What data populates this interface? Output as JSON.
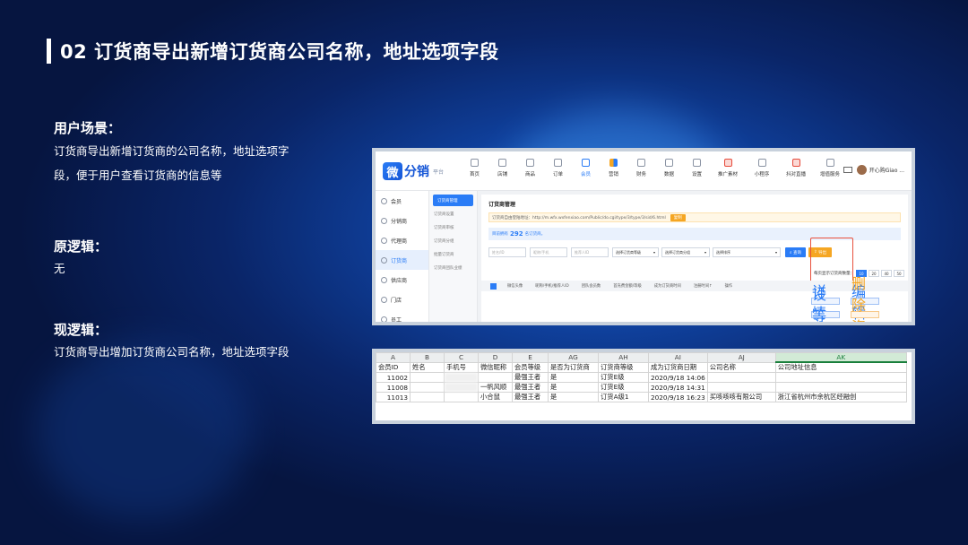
{
  "slide": {
    "title": "02 订货商导出新增订货商公司名称，地址选项字段",
    "sections": [
      {
        "heading": "用户场景：",
        "body": "订货商导出新增订货商的公司名称，地址选项字段，便于用户查看订货商的信息等"
      },
      {
        "heading": "原逻辑：",
        "body": "无"
      },
      {
        "heading": "现逻辑：",
        "body": "订货商导出增加订货商公司名称，地址选项字段"
      }
    ]
  },
  "app": {
    "logo_mark": "微",
    "logo_text": "分销",
    "logo_sub": "平台",
    "nav": [
      "首页",
      "店铺",
      "商品",
      "订单",
      "会员",
      "营销",
      "财务",
      "数据",
      "设置",
      "推广素材",
      "小程序",
      "抖对直播",
      "增值服务"
    ],
    "active_nav": "会员",
    "user_name": "开心购Giao ...",
    "sidebar": [
      "会员",
      "分销商",
      "代理商",
      "订货商",
      "供应商",
      "门店",
      "员工"
    ],
    "active_sidebar": "订货商",
    "subsidebar": [
      "订货商管理",
      "订货商设置",
      "订货商审核",
      "订货商分组",
      "批量订货商",
      "订货商团队业绩"
    ],
    "active_sub": "订货商管理",
    "page_title": "订货商管理",
    "link_text": "订货商自由登陆地址：http://m.wfx.wxfenxiao.com/Public/do.cgi/type/3/type/3/sid/6.html",
    "link_copy": "复制",
    "info_prefix": "目前拥有",
    "info_count": "292",
    "info_suffix": "名订货商。",
    "filters": {
      "inputs": [
        "姓名/ID",
        "昵称/手机",
        "推荐人ID"
      ],
      "selects": [
        "选择订货商等级",
        "选择订货商分组",
        "选择排序"
      ],
      "search_btn": "查询",
      "export_btn": "导出"
    },
    "page_size_label": "每页显示订货商数量：",
    "page_sizes": [
      "10",
      "20",
      "40",
      "50"
    ],
    "active_page_size": "10",
    "table_headers": [
      "微信头像",
      "昵称/手机/推荐人ID",
      "团队会员数",
      "首充费金额/等级",
      "成为订货商时间",
      "注册时间↑",
      "操作"
    ],
    "row_actions": [
      "详情",
      "编辑",
      "设等级",
      "删除资质"
    ]
  },
  "sheet": {
    "columns": [
      "A",
      "B",
      "C",
      "D",
      "E",
      "AG",
      "AH",
      "AI",
      "AJ",
      "AK"
    ],
    "selected_column": "AK",
    "header_row": [
      "会员ID",
      "姓名",
      "手机号",
      "微信昵称",
      "会员等级",
      "是否为订货商",
      "订货商等级",
      "成为订货商日期",
      "公司名称",
      "公司地址信息"
    ],
    "rows": [
      [
        "11002",
        "",
        "",
        "",
        "最强王者",
        "是",
        "订货E级",
        "2020/9/18 14:06",
        "",
        ""
      ],
      [
        "11008",
        "",
        "",
        "一帆风顺",
        "最强王者",
        "是",
        "订货E级",
        "2020/9/18 14:31",
        "",
        ""
      ],
      [
        "11013",
        "",
        "",
        "小合鼠",
        "最强王者",
        "是",
        "订货A级1",
        "2020/9/18 16:23",
        "买咳咳咳有限公司",
        "浙江省杭州市余杭区经融创"
      ]
    ]
  }
}
